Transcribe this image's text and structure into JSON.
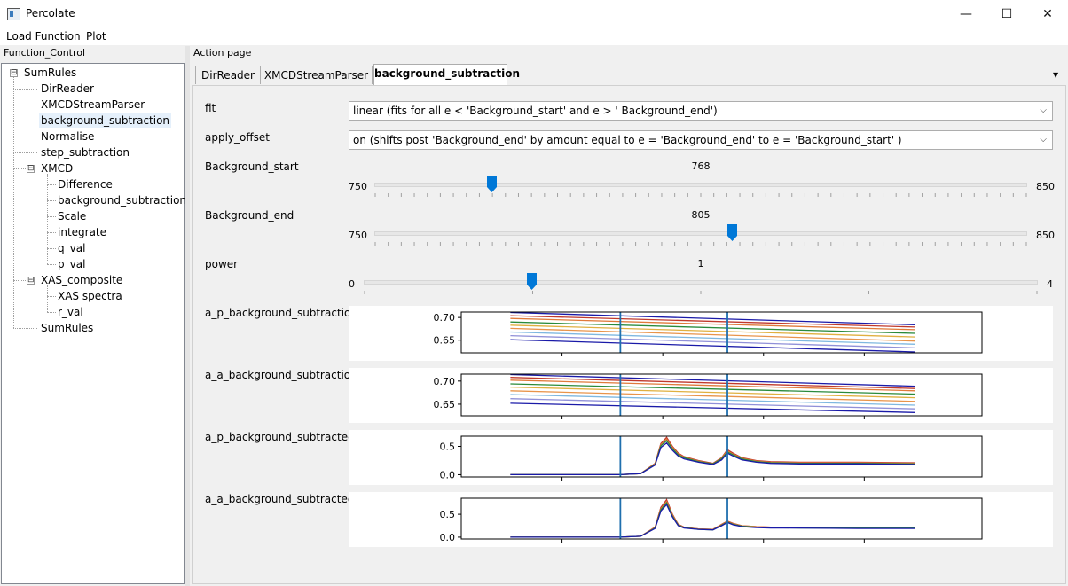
{
  "window": {
    "title": "Percolate",
    "controls": {
      "minimize": "—",
      "maximize": "☐",
      "close": "✕"
    }
  },
  "menu": [
    "Load Function",
    "Plot"
  ],
  "left_panel": {
    "title": "Function_Control",
    "tree": [
      {
        "label": "SumRules",
        "expander": "⊟"
      },
      {
        "label": "DirReader"
      },
      {
        "label": "XMCDStreamParser"
      },
      {
        "label": "background_subtraction",
        "selected": true
      },
      {
        "label": "Normalise"
      },
      {
        "label": "step_subtraction"
      },
      {
        "label": "XMCD",
        "expander": "⊟"
      },
      {
        "label": "Difference"
      },
      {
        "label": "background_subtraction"
      },
      {
        "label": "Scale"
      },
      {
        "label": "integrate"
      },
      {
        "label": "q_val"
      },
      {
        "label": "p_val"
      },
      {
        "label": "XAS_composite",
        "expander": "⊟"
      },
      {
        "label": "XAS spectra"
      },
      {
        "label": "r_val"
      },
      {
        "label": "SumRules"
      }
    ]
  },
  "right_panel": {
    "title": "Action page",
    "tabs": [
      "DirReader",
      "XMCDStreamParser",
      "background_subtraction"
    ],
    "active_tab": "background_subtraction",
    "tab_menu_icon": "▼",
    "fit": {
      "label": "fit",
      "value": "linear (fits for all e < 'Background_start' and e > ' Background_end')",
      "arrow": "⌵"
    },
    "apply_offset": {
      "label": "apply_offset",
      "value": "on (shifts post 'Background_end' by amount equal to e = 'Background_end' to e = 'Background_start' )",
      "arrow": "⌵"
    },
    "background_start": {
      "label": "Background_start",
      "value": "768",
      "min": "750",
      "max": "850",
      "level": 0.18
    },
    "background_end": {
      "label": "Background_end",
      "value": "805",
      "min": "750",
      "max": "850",
      "level": 0.55
    },
    "power": {
      "label": "power",
      "value": "1",
      "min": "0",
      "max": "4",
      "level": 0.25
    },
    "accent_color": "#0078d7"
  },
  "plots": [
    {
      "label": "a_p_background_subtraction",
      "chart_data": {
        "type": "line",
        "x": [
          730,
          870
        ],
        "yticks": [
          "0.70",
          "0.65"
        ],
        "ytick_values": [
          0.7,
          0.65
        ],
        "ylim": [
          0.622,
          0.712
        ],
        "xlim": [
          713,
          893
        ],
        "vlines": [
          768,
          805
        ],
        "series": [
          {
            "color": "#1a1aa8",
            "values": [
              0.711,
              0.684
            ]
          },
          {
            "color": "#c0392b",
            "values": [
              0.704,
              0.679
            ]
          },
          {
            "color": "#e07a3a",
            "values": [
              0.698,
              0.673
            ]
          },
          {
            "color": "#2a8a3a",
            "values": [
              0.69,
              0.665
            ]
          },
          {
            "color": "#e0b040",
            "values": [
              0.683,
              0.657
            ]
          },
          {
            "color": "#e8944a",
            "values": [
              0.676,
              0.648
            ]
          },
          {
            "color": "#7fb8e0",
            "values": [
              0.668,
              0.641
            ]
          },
          {
            "color": "#9090d8",
            "values": [
              0.66,
              0.633
            ]
          },
          {
            "color": "#1a1aa8",
            "values": [
              0.651,
              0.624
            ]
          }
        ]
      }
    },
    {
      "label": "a_a_background_subtraction",
      "chart_data": {
        "type": "line",
        "x": [
          730,
          870
        ],
        "yticks": [
          "0.70",
          "0.65"
        ],
        "ytick_values": [
          0.7,
          0.65
        ],
        "ylim": [
          0.625,
          0.715
        ],
        "xlim": [
          713,
          893
        ],
        "vlines": [
          768,
          805
        ],
        "series": [
          {
            "color": "#1a1aa8",
            "values": [
              0.714,
              0.689
            ]
          },
          {
            "color": "#c0392b",
            "values": [
              0.708,
              0.684
            ]
          },
          {
            "color": "#e07a3a",
            "values": [
              0.702,
              0.679
            ]
          },
          {
            "color": "#2a8a3a",
            "values": [
              0.694,
              0.672
            ]
          },
          {
            "color": "#e0b040",
            "values": [
              0.687,
              0.664
            ]
          },
          {
            "color": "#e8944a",
            "values": [
              0.679,
              0.656
            ]
          },
          {
            "color": "#7fb8e0",
            "values": [
              0.671,
              0.648
            ]
          },
          {
            "color": "#9090d8",
            "values": [
              0.662,
              0.64
            ]
          },
          {
            "color": "#1a1aa8",
            "values": [
              0.652,
              0.632
            ]
          }
        ]
      }
    },
    {
      "label": "a_p_background_subtracted",
      "chart_data": {
        "type": "line",
        "x": [
          730,
          745,
          760,
          768,
          775,
          780,
          782,
          784,
          786,
          788,
          790,
          795,
          800,
          803,
          805,
          807,
          810,
          815,
          820,
          830,
          850,
          870
        ],
        "yticks": [
          "0.5",
          "0.0"
        ],
        "ytick_values": [
          0.5,
          0.0
        ],
        "ylim": [
          -0.04,
          0.68
        ],
        "xlim": [
          713,
          893
        ],
        "vlines": [
          768,
          805
        ],
        "series": [
          {
            "color": "#c0392b",
            "values": [
              0.0,
              0.0,
              0.0,
              0.0,
              0.02,
              0.2,
              0.55,
              0.66,
              0.5,
              0.38,
              0.32,
              0.25,
              0.2,
              0.3,
              0.44,
              0.38,
              0.3,
              0.25,
              0.23,
              0.22,
              0.22,
              0.21
            ]
          },
          {
            "color": "#e07a3a",
            "values": [
              0.0,
              0.0,
              0.0,
              0.0,
              0.02,
              0.19,
              0.53,
              0.63,
              0.48,
              0.36,
              0.31,
              0.24,
              0.19,
              0.29,
              0.42,
              0.36,
              0.29,
              0.24,
              0.22,
              0.21,
              0.21,
              0.2
            ]
          },
          {
            "color": "#2a8a3a",
            "values": [
              0.0,
              0.0,
              0.0,
              0.0,
              0.02,
              0.18,
              0.51,
              0.6,
              0.46,
              0.35,
              0.3,
              0.23,
              0.19,
              0.28,
              0.4,
              0.35,
              0.28,
              0.23,
              0.21,
              0.2,
              0.2,
              0.19
            ]
          },
          {
            "color": "#1a1aa8",
            "values": [
              0.0,
              0.0,
              0.0,
              0.0,
              0.02,
              0.17,
              0.48,
              0.56,
              0.43,
              0.33,
              0.28,
              0.22,
              0.18,
              0.26,
              0.38,
              0.33,
              0.26,
              0.22,
              0.2,
              0.19,
              0.19,
              0.18
            ]
          }
        ]
      }
    },
    {
      "label": "a_a_background_subtracted",
      "chart_data": {
        "type": "line",
        "x": [
          730,
          745,
          760,
          768,
          775,
          780,
          782,
          784,
          786,
          788,
          790,
          795,
          800,
          803,
          805,
          807,
          810,
          815,
          820,
          830,
          850,
          870
        ],
        "yticks": [
          "0.5",
          "0.0"
        ],
        "ytick_values": [
          0.5,
          0.0
        ],
        "ylim": [
          -0.04,
          0.85
        ],
        "xlim": [
          713,
          893
        ],
        "vlines": [
          768,
          805
        ],
        "series": [
          {
            "color": "#c0392b",
            "values": [
              0.0,
              0.0,
              0.0,
              0.0,
              0.02,
              0.22,
              0.65,
              0.82,
              0.5,
              0.28,
              0.22,
              0.18,
              0.17,
              0.28,
              0.35,
              0.3,
              0.25,
              0.23,
              0.22,
              0.21,
              0.21,
              0.21
            ]
          },
          {
            "color": "#e07a3a",
            "values": [
              0.0,
              0.0,
              0.0,
              0.0,
              0.02,
              0.21,
              0.62,
              0.78,
              0.48,
              0.27,
              0.21,
              0.18,
              0.17,
              0.27,
              0.34,
              0.29,
              0.25,
              0.23,
              0.22,
              0.21,
              0.21,
              0.2
            ]
          },
          {
            "color": "#2a8a3a",
            "values": [
              0.0,
              0.0,
              0.0,
              0.0,
              0.02,
              0.2,
              0.6,
              0.75,
              0.46,
              0.26,
              0.21,
              0.17,
              0.16,
              0.26,
              0.33,
              0.28,
              0.24,
              0.22,
              0.21,
              0.2,
              0.2,
              0.2
            ]
          },
          {
            "color": "#1a1aa8",
            "values": [
              0.0,
              0.0,
              0.0,
              0.0,
              0.02,
              0.19,
              0.57,
              0.71,
              0.44,
              0.25,
              0.2,
              0.17,
              0.16,
              0.25,
              0.32,
              0.27,
              0.23,
              0.21,
              0.2,
              0.2,
              0.19,
              0.19
            ]
          }
        ]
      }
    }
  ]
}
